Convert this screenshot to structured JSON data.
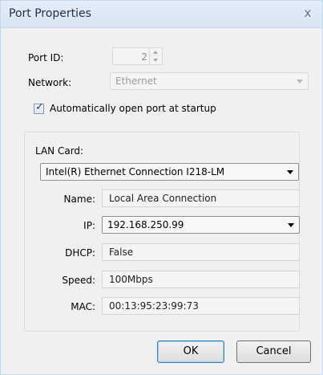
{
  "window": {
    "title": "Port Properties",
    "close_glyph": "x"
  },
  "port": {
    "id_label": "Port ID:",
    "id_value": "2",
    "network_label": "Network:",
    "network_value": "Ethernet",
    "auto_open_label": "Automatically open port at startup",
    "auto_open_checked": true
  },
  "lan": {
    "group_label": "LAN Card:",
    "card_value": "Intel(R) Ethernet Connection I218-LM",
    "name_label": "Name:",
    "name_value": "Local Area Connection",
    "ip_label": "IP:",
    "ip_value": "192.168.250.99",
    "dhcp_label": "DHCP:",
    "dhcp_value": "False",
    "speed_label": "Speed:",
    "speed_value": "100Mbps",
    "mac_label": "MAC:",
    "mac_value": "00:13:95:23:99:73"
  },
  "buttons": {
    "ok_label": "OK",
    "cancel_label": "Cancel"
  },
  "colors": {
    "titlebar": "#dde8f5",
    "window_bg": "#f0f0f0",
    "default_button_border": "#3c7fb1"
  },
  "icons": {
    "close": "close-icon",
    "checkbox": "checkmark-icon",
    "dropdown": "chevron-down-icon",
    "spin_up": "spin-up-icon",
    "spin_down": "spin-down-icon"
  }
}
